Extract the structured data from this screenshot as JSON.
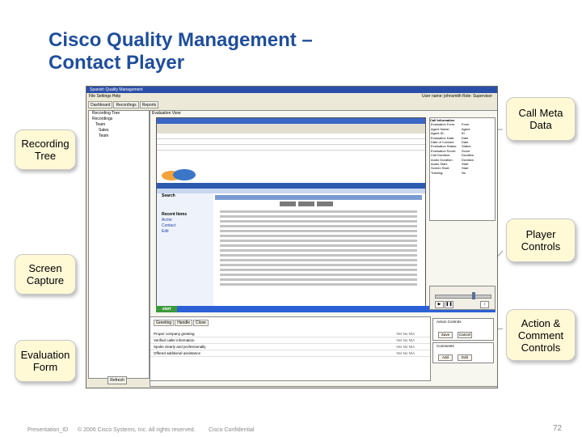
{
  "slide": {
    "title_line1": "Cisco Quality Management –",
    "title_line2": "Contact Player",
    "page_number": "72"
  },
  "callouts": {
    "recording_tree": "Recording Tree",
    "screen_capture": "Screen Capture",
    "evaluation_form": "Evaluation Form",
    "call_meta_data": "Call Meta Data",
    "player_controls": "Player Controls",
    "action_comment_controls": "Action & Comment Controls"
  },
  "footer": {
    "presentation_id": "Presentation_ID",
    "copyright": "© 2006 Cisco Systems, Inc. All rights reserved.",
    "confidential": "Cisco Confidential"
  },
  "app": {
    "window_title": "Spanish Quality Management",
    "menu": "File   Settings   Help",
    "user_info": "User name: johnsmith   Role: Supervisor",
    "tabs": [
      "Dashboard",
      "Recordings",
      "Reports"
    ],
    "tree_header": "Recording Tree",
    "tree_items": [
      "Recordings",
      "Team",
      "Sales",
      "Team"
    ],
    "refresh_label": "Refresh",
    "eval_view_title": "Evaluation View",
    "meta_title": "Call Information",
    "meta_rows": [
      {
        "k": "Evaluation Form:",
        "v": "Form"
      },
      {
        "k": "Agent Name:",
        "v": "Agent"
      },
      {
        "k": "Agent ID:",
        "v": "ID"
      },
      {
        "k": "Evaluation Date:",
        "v": "Date"
      },
      {
        "k": "Date of Contact:",
        "v": "Date"
      },
      {
        "k": "Evaluation Status:",
        "v": "Status"
      },
      {
        "k": "Evaluation Score:",
        "v": "Score"
      },
      {
        "k": "Call Duration:",
        "v": "Duration"
      },
      {
        "k": "Audio Duration:",
        "v": "Duration"
      },
      {
        "k": "Audio Start:",
        "v": "Start"
      },
      {
        "k": "Screen Start:",
        "v": "Start"
      },
      {
        "k": "Training:",
        "v": "No"
      }
    ],
    "sf_search": "Search",
    "sf_side_items": [
      "Recent Items",
      "Acme",
      "Contact",
      "Edit"
    ],
    "taskbar_start": "start",
    "form_tabs": [
      "Greeting",
      "Handle",
      "Close"
    ],
    "questions": [
      "Proper company greeting",
      "Verified caller information",
      "Spoke clearly and professionally",
      "Offered additional assistance"
    ],
    "question_options": "Yes  No  N/A",
    "action_title": "Action Controls",
    "action_buttons": [
      "Save",
      "Cancel"
    ],
    "comment_title": "Comments",
    "comment_buttons": [
      "Add",
      "Edit"
    ]
  }
}
